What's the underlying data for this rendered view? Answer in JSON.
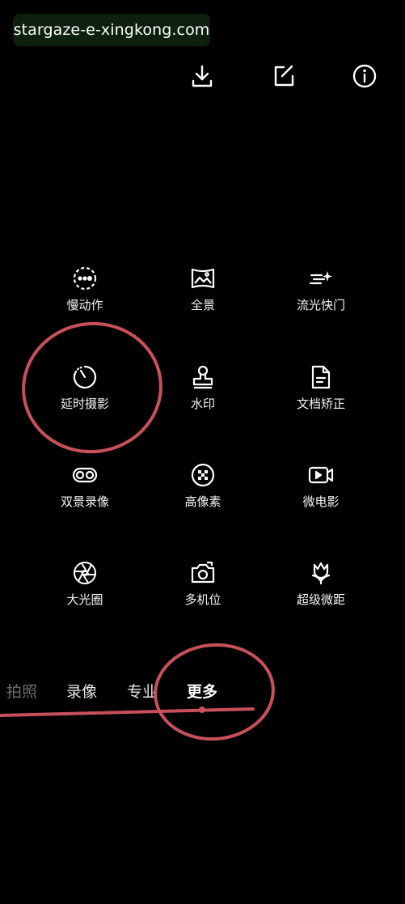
{
  "watermark": "stargaze-e-xingkong.com",
  "top_icons": [
    "download-icon",
    "edit-icon",
    "info-icon"
  ],
  "modes": [
    {
      "label": "慢动作",
      "icon": "slow-motion-icon"
    },
    {
      "label": "全景",
      "icon": "panorama-icon"
    },
    {
      "label": "流光快门",
      "icon": "light-painting-icon"
    },
    {
      "label": "延时摄影",
      "icon": "time-lapse-icon"
    },
    {
      "label": "水印",
      "icon": "watermark-stamp-icon"
    },
    {
      "label": "文档矫正",
      "icon": "document-icon"
    },
    {
      "label": "双景录像",
      "icon": "dual-view-icon"
    },
    {
      "label": "高像素",
      "icon": "high-resolution-icon"
    },
    {
      "label": "微电影",
      "icon": "micro-movie-icon"
    },
    {
      "label": "大光圈",
      "icon": "aperture-icon"
    },
    {
      "label": "多机位",
      "icon": "multi-camera-icon"
    },
    {
      "label": "超级微距",
      "icon": "super-macro-icon"
    }
  ],
  "tabs": [
    {
      "label": "拍照"
    },
    {
      "label": "录像"
    },
    {
      "label": "专业"
    },
    {
      "label": "更多",
      "active": true
    }
  ],
  "annotation_color": "#c8505a"
}
